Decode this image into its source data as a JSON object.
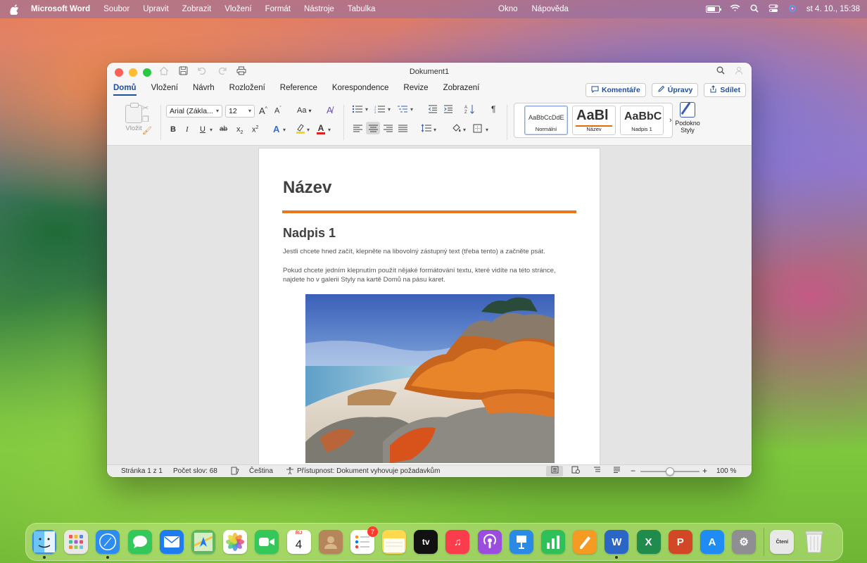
{
  "menubar": {
    "app_name": "Microsoft Word",
    "menus": [
      "Soubor",
      "Upravit",
      "Zobrazit",
      "Vložení",
      "Formát",
      "Nástroje",
      "Tabulka"
    ],
    "menus_right": [
      "Okno",
      "Nápověda"
    ],
    "datetime": "st 4. 10., 15:38"
  },
  "window": {
    "title": "Dokument1",
    "tabs": [
      "Domů",
      "Vložení",
      "Návrh",
      "Rozložení",
      "Reference",
      "Korespondence",
      "Revize",
      "Zobrazení"
    ],
    "active_tab": "Domů",
    "actions": {
      "comments": "Komentáře",
      "editing": "Úpravy",
      "share": "Sdílet"
    }
  },
  "ribbon": {
    "paste_label": "Vložit",
    "font_name": "Arial (Zákla...",
    "font_size": "12",
    "grow": "A",
    "shrink": "A",
    "change_case": "Aa",
    "bold": "B",
    "italic": "I",
    "underline": "U",
    "strikethrough": "ab",
    "subscript": "x",
    "superscript": "x",
    "text_effects": "A",
    "font_color": "A",
    "pilcrow": "¶",
    "styles": [
      {
        "sample": "AaBbCcDdE",
        "label": "Normální"
      },
      {
        "sample": "AaBl",
        "label": "Název"
      },
      {
        "sample": "AaBbC",
        "label": "Nadpis 1"
      }
    ],
    "styles_pane_line1": "Podokno",
    "styles_pane_line2": "Styly"
  },
  "document": {
    "title": "Název",
    "heading1": "Nadpis 1",
    "paragraph1": "Jestli chcete hned začít, klepněte na libovolný zástupný text (třeba tento) a začněte psát.",
    "paragraph2": "Pokud chcete jedním klepnutím použít nějaké formátování textu, které vidíte na této stránce, najdete ho v galerii Styly na kartě Domů na pásu karet.",
    "image_alt": "Pobřeží s oranžovými balvany"
  },
  "statusbar": {
    "page": "Stránka 1 z 1",
    "word_count": "Počet slov: 68",
    "language": "Čeština",
    "accessibility": "Přístupnost: Dokument vyhovuje požadavkům",
    "zoom": "100 %",
    "zoom_level": 0.5
  },
  "dock": {
    "apps": [
      {
        "name": "finder",
        "color": "#3a8ee6",
        "glyph": "",
        "running": true
      },
      {
        "name": "launchpad",
        "color": "#e8e8e8",
        "glyph": "",
        "running": false
      },
      {
        "name": "safari",
        "color": "#2d8cf0",
        "glyph": "",
        "running": true
      },
      {
        "name": "messages",
        "color": "#34c759",
        "glyph": "",
        "running": false
      },
      {
        "name": "mail",
        "color": "#1e7cf2",
        "glyph": "",
        "running": false
      },
      {
        "name": "maps",
        "color": "#5fb760",
        "glyph": "",
        "running": false
      },
      {
        "name": "photos",
        "color": "#ffffff",
        "glyph": "",
        "running": false
      },
      {
        "name": "facetime",
        "color": "#34c759",
        "glyph": "",
        "running": false
      },
      {
        "name": "calendar",
        "color": "#ffffff",
        "glyph": "4",
        "running": false
      },
      {
        "name": "contacts",
        "color": "#b5865a",
        "glyph": "",
        "running": false
      },
      {
        "name": "reminders",
        "color": "#ffffff",
        "glyph": "",
        "running": false,
        "badge": "7"
      },
      {
        "name": "notes",
        "color": "#ffd84d",
        "glyph": "",
        "running": false
      },
      {
        "name": "apple-tv",
        "color": "#111111",
        "glyph": "tv",
        "running": false
      },
      {
        "name": "music",
        "color": "#fa3c4c",
        "glyph": "♫",
        "running": false
      },
      {
        "name": "podcasts",
        "color": "#9b4de0",
        "glyph": "",
        "running": false
      },
      {
        "name": "keynote",
        "color": "#2b8ae6",
        "glyph": "",
        "running": false
      },
      {
        "name": "numbers",
        "color": "#30c05a",
        "glyph": "",
        "running": false
      },
      {
        "name": "pages",
        "color": "#f59a23",
        "glyph": "",
        "running": false
      },
      {
        "name": "word",
        "color": "#2b65c5",
        "glyph": "W",
        "running": true
      },
      {
        "name": "excel",
        "color": "#1f8b4c",
        "glyph": "X",
        "running": false
      },
      {
        "name": "powerpoint",
        "color": "#d24726",
        "glyph": "P",
        "running": false
      },
      {
        "name": "app-store",
        "color": "#1f8cf5",
        "glyph": "A",
        "running": false
      },
      {
        "name": "system-settings",
        "color": "#8e8e93",
        "glyph": "⚙",
        "running": false
      }
    ],
    "trailing": [
      {
        "name": "reading-folder",
        "label": "Čtení"
      },
      {
        "name": "trash",
        "label": ""
      }
    ],
    "calendar_month": "ŘÍJ"
  },
  "colors": {
    "accent": "#1f4e9c",
    "title_rule": "#e8761b"
  }
}
